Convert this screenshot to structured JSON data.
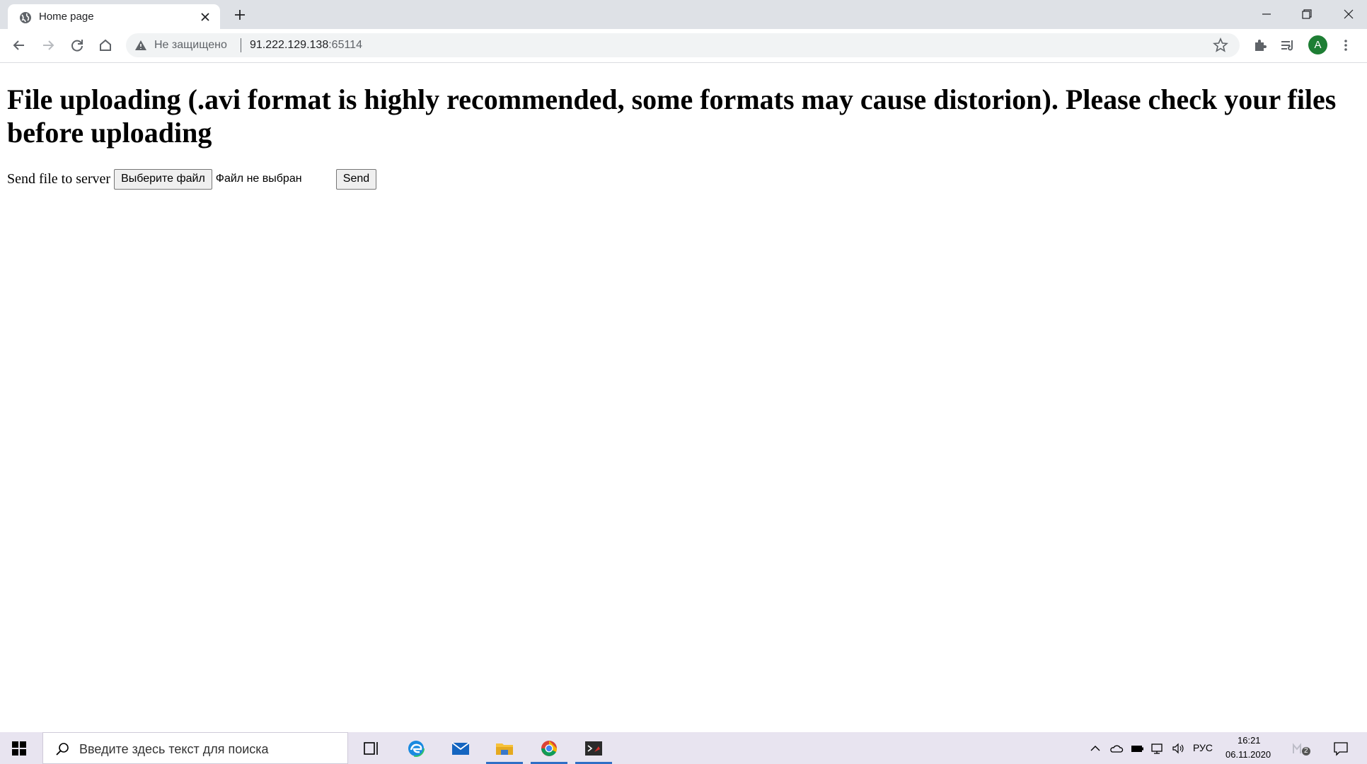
{
  "browser": {
    "tab_title": "Home page",
    "security_label": "Не защищено",
    "url_host": "91.222.129.138",
    "url_port": ":65114",
    "profile_initial": "A",
    "profile_color": "#1e7e34"
  },
  "page": {
    "heading": "File uploading (.avi format is highly recommended, some formats may cause distorion). Please check your files before uploading",
    "form_label": "Send file to server",
    "choose_file_label": "Выберите файл",
    "no_file_text": "Файл не выбран",
    "send_label": "Send"
  },
  "taskbar": {
    "search_placeholder": "Введите здесь текст для поиска",
    "language": "РУС",
    "time": "16:21",
    "date": "06.11.2020",
    "notification_count": "2",
    "apps": [
      "task-view",
      "edge",
      "mail",
      "file-explorer",
      "chrome",
      "terminal"
    ]
  }
}
